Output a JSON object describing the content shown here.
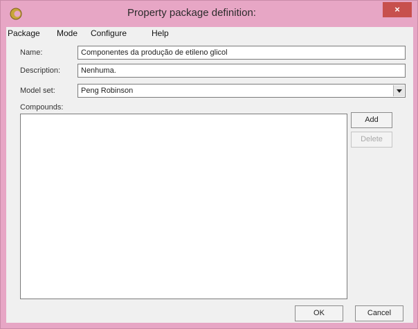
{
  "window": {
    "title": "Property package definition:",
    "close_glyph": "×"
  },
  "menu": {
    "items": [
      "Package",
      "Mode",
      "Configure",
      "Help"
    ]
  },
  "form": {
    "name_label": "Name:",
    "name_value": "Componentes da produção de etileno glicol",
    "description_label": "Description:",
    "description_value": "Nenhuma.",
    "model_set_label": "Model set:",
    "model_set_value": "Peng Robinson",
    "compounds_label": "Compounds:"
  },
  "buttons": {
    "add": "Add",
    "delete": "Delete",
    "ok": "OK",
    "cancel": "Cancel"
  },
  "colors": {
    "titlebar": "#e7a6c5",
    "close": "#c7504d",
    "client": "#f0f0f0"
  }
}
